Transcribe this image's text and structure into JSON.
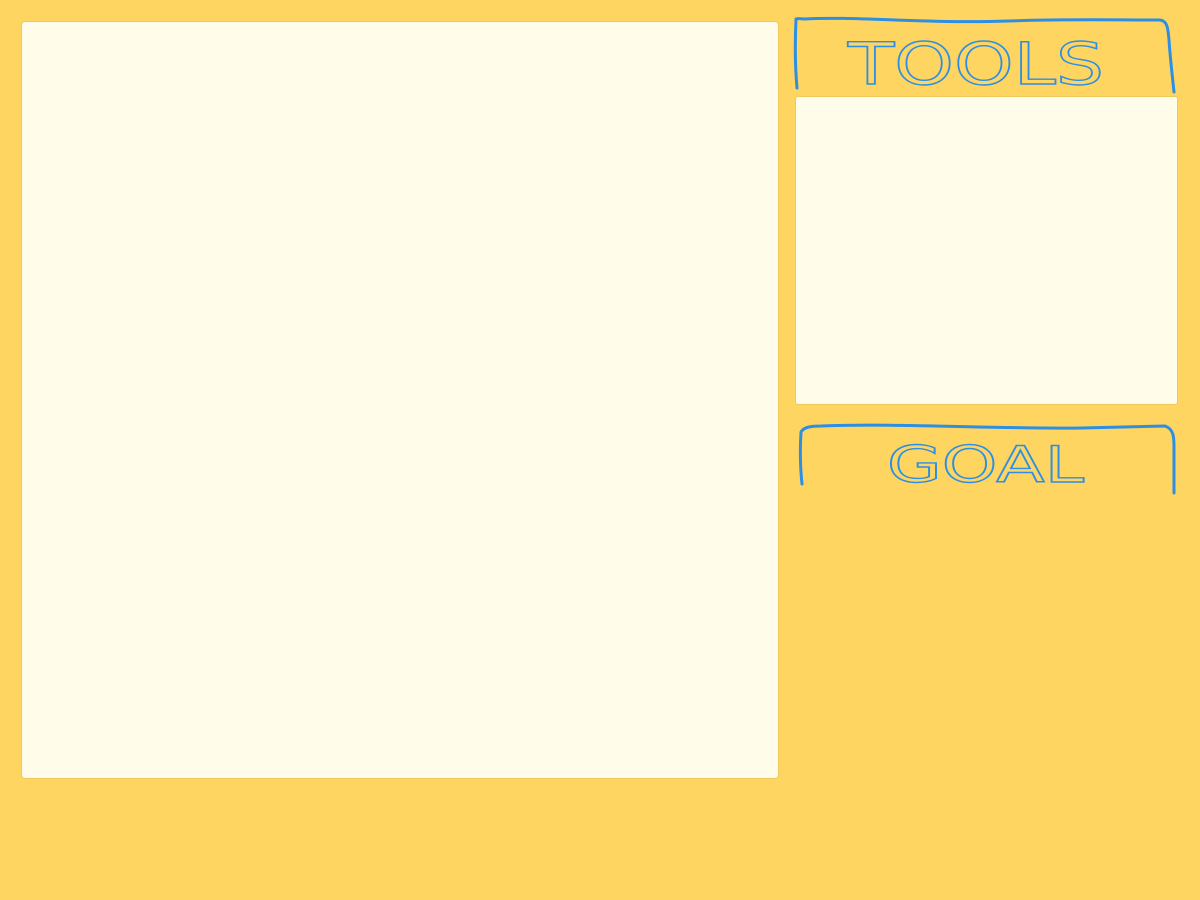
{
  "colors": {
    "background": "#FFD561",
    "panel": "#FFFCE9",
    "sketch_ink": "#2D8FE3"
  },
  "tools_tab": {
    "label": "TOOLS"
  },
  "goal_tab": {
    "label": "GOAL"
  }
}
